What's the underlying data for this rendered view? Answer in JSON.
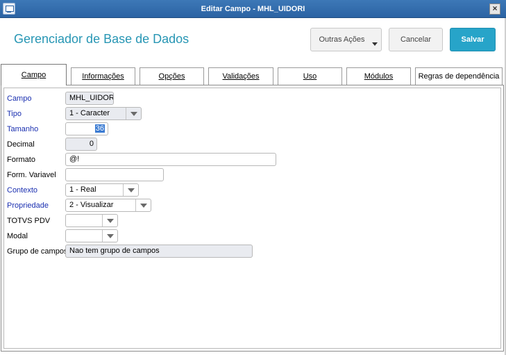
{
  "window": {
    "title": "Editar Campo - MHL_UIDORI",
    "close_glyph": "×",
    "icons": [
      "app-icon",
      "close-icon"
    ]
  },
  "header": {
    "page_title": "Gerenciador de Base de Dados",
    "actions": {
      "outras": "Outras Ações",
      "cancelar": "Cancelar",
      "salvar": "Salvar"
    }
  },
  "tabs": [
    {
      "label": "Campo",
      "active": true
    },
    {
      "label": "Informações"
    },
    {
      "label": "Opções"
    },
    {
      "label": "Validações"
    },
    {
      "label": "Uso"
    },
    {
      "label": "Módulos"
    },
    {
      "label": "Regras de dependência"
    }
  ],
  "form": {
    "campo": {
      "label": "Campo",
      "value": "MHL_UIDORI"
    },
    "tipo": {
      "label": "Tipo",
      "value": "1 - Caracter"
    },
    "tamanho": {
      "label": "Tamanho",
      "value": "36"
    },
    "decimal": {
      "label": "Decimal",
      "value": "0"
    },
    "formato": {
      "label": "Formato",
      "value": "@!"
    },
    "form_variavel": {
      "label": "Form. Variavel",
      "value": ""
    },
    "contexto": {
      "label": "Contexto",
      "value": "1 - Real"
    },
    "propriedade": {
      "label": "Propriedade",
      "value": "2 - Visualizar"
    },
    "totvs_pdv": {
      "label": "TOTVS PDV",
      "value": ""
    },
    "modal": {
      "label": "Modal",
      "value": ""
    },
    "grupo_campos": {
      "label": "Grupo de campos",
      "value": "Nao tem grupo de campos"
    }
  },
  "colors": {
    "titlebar": "#2b63a3",
    "accent": "#27a4c9",
    "page_title": "#2796b4",
    "required_label": "#1a2fb0"
  }
}
